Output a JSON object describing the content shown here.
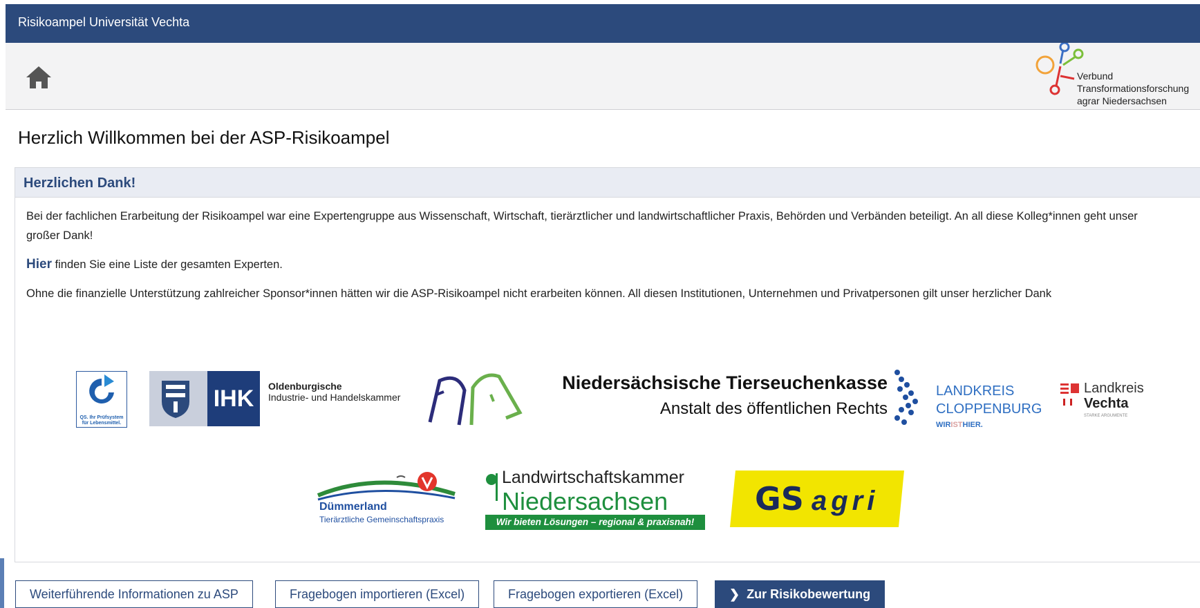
{
  "app": {
    "title": "Risikoampel Universität Vechta"
  },
  "nav": {
    "home_icon": "home-icon",
    "partner_logo_lines": [
      "Verbund",
      "Transformationsforschung",
      "agrar Niedersachsen"
    ]
  },
  "page": {
    "heading": "Herzlich Willkommen bei der ASP-Risikoampel"
  },
  "panel": {
    "title": "Herzlichen Dank!",
    "para1": "Bei der fachlichen Erarbeitung der Risikoampel war eine Expertengruppe aus Wissenschaft, Wirtschaft, tierärztlicher und landwirtschaftlicher Praxis, Behörden und Verbänden beteiligt. An all diese Kolleg*innen geht unser großer Dank!",
    "para2_link": "Hier",
    "para2_rest": " finden Sie eine Liste der gesamten Experten.",
    "para3": "Ohne die finanzielle Unterstützung zahlreicher Sponsor*innen hätten wir die ASP-Risikoampel nicht erarbeiten können. All diesen Institutionen, Unternehmen und Privatpersonen gilt unser herzlicher Dank"
  },
  "sponsors": {
    "qs_lines": [
      "QS. Ihr Prüfsystem",
      "für Lebensmittel."
    ],
    "ihk": "IHK",
    "ihk_name_1": "Oldenburgische",
    "ihk_name_2": "Industrie- und Handelskammer",
    "tsk_name": "Niedersächsische Tierseuchenkasse",
    "tsk_sub": "Anstalt des öffentlichen Rechts",
    "clp_1": "LANDKREIS",
    "clp_2": "CLOPPENBURG",
    "clp_slogan_a": "WIR",
    "clp_slogan_b": "IST",
    "clp_slogan_c": "HIER.",
    "vechta_1": "Landkreis",
    "vechta_2": "Vechta",
    "vechta_3": "STARKE ARGUMENTE",
    "duemmer_1": "Dümmerland",
    "duemmer_2": "Tierärztliche Gemeinschaftspraxis",
    "lwk_1": "Landwirtschaftskammer",
    "lwk_2": "Niedersachsen",
    "lwk_3": "Wir bieten Lösungen – regional & praxisnah!",
    "gs_1": "GS",
    "gs_2": "agri"
  },
  "buttons": {
    "info": "Weiterführende Informationen zu ASP",
    "import": "Fragebogen importieren (Excel)",
    "export": "Fragebogen exportieren (Excel)",
    "risk": "Zur Risikobewertung"
  },
  "colors": {
    "brand": "#2c4a7c",
    "panel_header": "#e9ecf3",
    "lwk_green": "#1e8f3e",
    "gs_yellow": "#f2e500"
  }
}
